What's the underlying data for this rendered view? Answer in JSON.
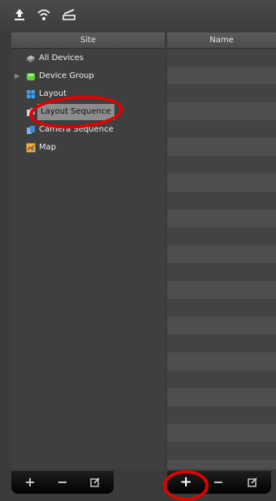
{
  "toolbar": {
    "icons": [
      "upload-icon",
      "wifi-icon",
      "scanner-icon"
    ]
  },
  "left_panel": {
    "header": "Site",
    "tree": [
      {
        "label": "All Devices",
        "icon": "all-devices-icon",
        "expandable": false
      },
      {
        "label": "Device Group",
        "icon": "device-group-icon",
        "expandable": true
      },
      {
        "label": "Layout",
        "icon": "layout-icon",
        "expandable": false
      },
      {
        "label": "Layout Sequence",
        "icon": "layout-sequence-icon",
        "expandable": false,
        "selected": true
      },
      {
        "label": "Camera Sequence",
        "icon": "camera-sequence-icon",
        "expandable": false
      },
      {
        "label": "Map",
        "icon": "map-icon",
        "expandable": false
      }
    ]
  },
  "right_panel": {
    "header": "Name"
  },
  "bottom_left": {
    "add": "+",
    "remove": "−",
    "edit_icon": "edit-icon"
  },
  "bottom_right": {
    "add": "+",
    "remove": "−",
    "edit_icon": "edit-icon"
  },
  "colors": {
    "annotation": "#e00000",
    "selection": "#8c8c8c",
    "panel": "#3f3f3f"
  }
}
